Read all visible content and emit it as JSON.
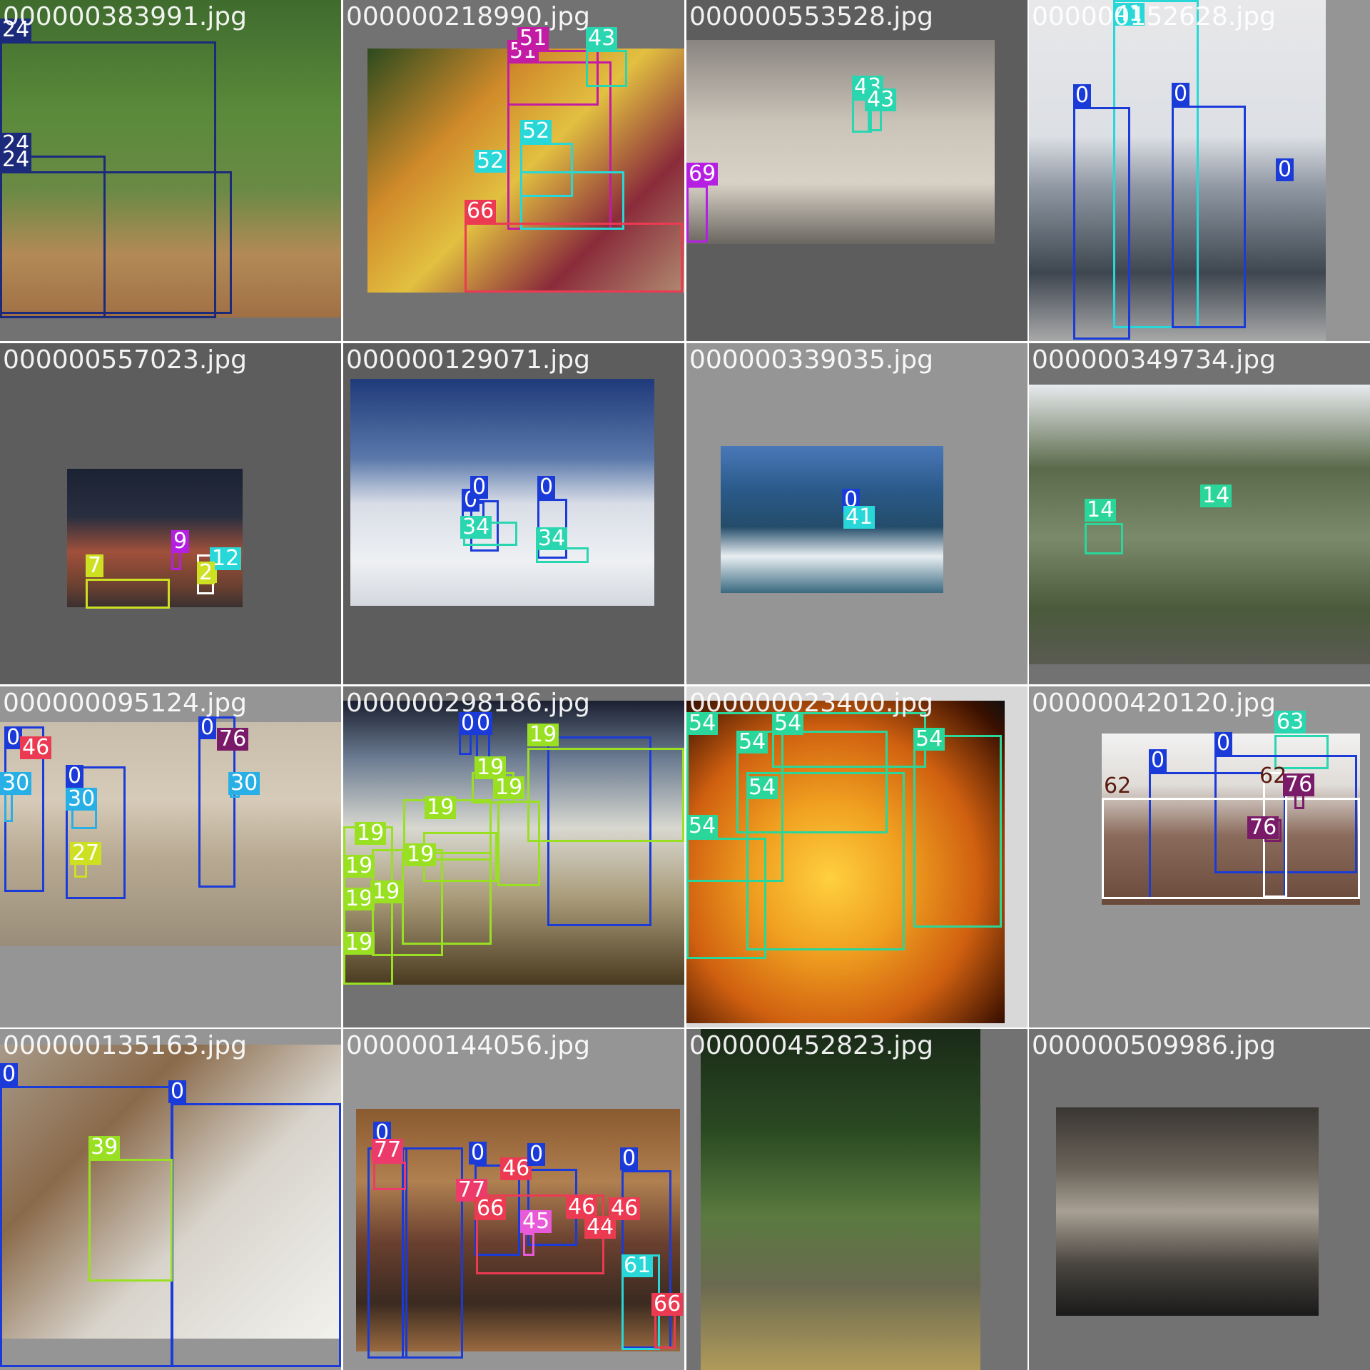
{
  "mosaic": {
    "tiles": [
      {
        "filename": "000000383991.jpg",
        "background": "#727272",
        "photo_fill": "linear-gradient(180deg,#3f6b2e 0%,#5a8a3a 35%,#6a8a45 60%,#b38a56 80%,#a07045 100%)",
        "labels": [
          {
            "text": "24",
            "color": "#1b2a7a"
          },
          {
            "text": "24",
            "color": "#1b2a7a"
          },
          {
            "text": "24",
            "color": "#1b2a7a"
          }
        ]
      },
      {
        "filename": "000000218990.jpg",
        "background": "#727272",
        "photo_fill": "linear-gradient(135deg,#2c4a1e 0%,#d08a2a 30%,#e2c040 50%,#8a2b3a 75%,#b08a70 100%)",
        "labels": [
          {
            "text": "51",
            "color": "#c41ba5"
          },
          {
            "text": "51",
            "color": "#c41ba5"
          },
          {
            "text": "43",
            "color": "#2ad6b0"
          },
          {
            "text": "52",
            "color": "#28d7d7"
          },
          {
            "text": "52",
            "color": "#28d7d7"
          },
          {
            "text": "66",
            "color": "#ec3a52"
          }
        ]
      },
      {
        "filename": "000000553528.jpg",
        "background": "#5d5d5d",
        "photo_fill": "linear-gradient(180deg,#8a8580 0%,#c9c3b8 40%,#d8d2c6 70%,#6a6660 100%)",
        "labels": [
          {
            "text": "43",
            "color": "#2ad6b0"
          },
          {
            "text": "43",
            "color": "#2ad6b0"
          },
          {
            "text": "69",
            "color": "#b51fe1"
          }
        ]
      },
      {
        "filename": "000000152628.jpg",
        "background": "#959595",
        "photo_fill": "linear-gradient(180deg,#e8e8ea 0%,#dcdfe4 40%,#8f97a2 55%,#3e4650 80%,#a8a8a8 100%)",
        "labels": [
          {
            "text": "41",
            "color": "#28d7d7"
          },
          {
            "text": "0",
            "color": "#1b3bd9"
          },
          {
            "text": "0",
            "color": "#1b3bd9"
          },
          {
            "text": "0",
            "color": "#1b3bd9"
          }
        ]
      },
      {
        "filename": "000000557023.jpg",
        "background": "#5d5d5d",
        "photo_fill": "linear-gradient(180deg,#1a2233 0%,#2a2f40 35%,#a0503a 60%,#6a4030 85%,#3a3030 100%)",
        "labels": [
          {
            "text": "9",
            "color": "#b51fe1"
          },
          {
            "text": "12",
            "color": "#28d7d7"
          },
          {
            "text": "7",
            "color": "#cde022"
          },
          {
            "text": "2",
            "color": "#cde022"
          }
        ]
      },
      {
        "filename": "000000129071.jpg",
        "background": "#5d5d5d",
        "photo_fill": "linear-gradient(180deg,#1f3a7a 0%,#5a78aa 35%,#d8dde6 55%,#eef0f3 80%,#d4d8de 100%)",
        "labels": [
          {
            "text": "0",
            "color": "#1b3bd9"
          },
          {
            "text": "0",
            "color": "#1b3bd9"
          },
          {
            "text": "0",
            "color": "#1b3bd9"
          },
          {
            "text": "34",
            "color": "#2ad6b0"
          },
          {
            "text": "34",
            "color": "#2ad6b0"
          }
        ]
      },
      {
        "filename": "000000339035.jpg",
        "background": "#959595",
        "photo_fill": "linear-gradient(180deg,#4a78b8 0%,#2a5a8a 30%,#244c6a 55%,#e8eef2 75%,#3a6a80 100%)",
        "labels": [
          {
            "text": "0",
            "color": "#1b3bd9"
          },
          {
            "text": "41",
            "color": "#28d7d7"
          }
        ]
      },
      {
        "filename": "000000349734.jpg",
        "background": "#727272",
        "photo_fill": "linear-gradient(180deg,#e8eaee 0%,#5a6a4a 30%,#7a8a6a 55%,#4a5a3a 80%,#5a5a52 100%)",
        "labels": [
          {
            "text": "14",
            "color": "#2ad69a"
          },
          {
            "text": "14",
            "color": "#2ad69a"
          }
        ]
      },
      {
        "filename": "000000095124.jpg",
        "background": "#959595",
        "photo_fill": "linear-gradient(180deg,#c8bcaa 0%,#d6cab8 35%,#b8aa92 60%,#9a8e7a 100%)",
        "labels": [
          {
            "text": "0",
            "color": "#1b3bd9"
          },
          {
            "text": "46",
            "color": "#ec3a52"
          },
          {
            "text": "0",
            "color": "#1b3bd9"
          },
          {
            "text": "76",
            "color": "#7a1b6a"
          },
          {
            "text": "30",
            "color": "#28b0e6"
          },
          {
            "text": "0",
            "color": "#1b3bd9"
          },
          {
            "text": "30",
            "color": "#28b0e6"
          },
          {
            "text": "30",
            "color": "#28b0e6"
          },
          {
            "text": "27",
            "color": "#cde022"
          }
        ]
      },
      {
        "filename": "000000298186.jpg",
        "background": "#727272",
        "photo_fill": "linear-gradient(180deg,#1a2030 0%,#6a7a90 20%,#d8d8d0 45%,#a89a78 70%,#4a3a20 100%)",
        "labels": [
          {
            "text": "0",
            "color": "#1b3bd9"
          },
          {
            "text": "0",
            "color": "#1b3bd9"
          },
          {
            "text": "19",
            "color": "#9ae022"
          },
          {
            "text": "19",
            "color": "#9ae022"
          },
          {
            "text": "19",
            "color": "#9ae022"
          },
          {
            "text": "19",
            "color": "#9ae022"
          },
          {
            "text": "19",
            "color": "#9ae022"
          },
          {
            "text": "19",
            "color": "#9ae022"
          },
          {
            "text": "19",
            "color": "#9ae022"
          },
          {
            "text": "19",
            "color": "#9ae022"
          },
          {
            "text": "19",
            "color": "#9ae022"
          },
          {
            "text": "19",
            "color": "#9ae022"
          }
        ]
      },
      {
        "filename": "000000023400.jpg",
        "background": "#d8d8d8",
        "photo_fill": "radial-gradient(ellipse at 45% 55%,#ffd040 0%,#f0a020 30%,#d06010 60%,#3a1000 90%,#101010 100%)",
        "labels": [
          {
            "text": "54",
            "color": "#2ad69a"
          },
          {
            "text": "54",
            "color": "#2ad69a"
          },
          {
            "text": "54",
            "color": "#2ad69a"
          },
          {
            "text": "54",
            "color": "#2ad69a"
          },
          {
            "text": "54",
            "color": "#2ad69a"
          },
          {
            "text": "54",
            "color": "#2ad69a"
          }
        ]
      },
      {
        "filename": "000000420120.jpg",
        "background": "#959595",
        "photo_fill": "linear-gradient(180deg,#f2f2f2 0%,#e0dcd8 30%,#8a6a5a 60%,#6a4a3a 100%)",
        "labels": [
          {
            "text": "63",
            "color": "#2ad6b0"
          },
          {
            "text": "0",
            "color": "#1b3bd9"
          },
          {
            "text": "0",
            "color": "#1b3bd9"
          },
          {
            "text": "62",
            "color": "#ffffff"
          },
          {
            "text": "62",
            "color": "#ffffff"
          },
          {
            "text": "76",
            "color": "#7a1b6a"
          },
          {
            "text": "76",
            "color": "#7a1b6a"
          }
        ]
      },
      {
        "filename": "000000135163.jpg",
        "background": "#959595",
        "photo_fill": "linear-gradient(135deg,#a89a8a 0%,#8a6a4a 30%,#d8d4cc 60%,#f2f2ee 100%)",
        "labels": [
          {
            "text": "0",
            "color": "#1b3bd9"
          },
          {
            "text": "0",
            "color": "#1b3bd9"
          },
          {
            "text": "39",
            "color": "#9ae022"
          }
        ]
      },
      {
        "filename": "000000144056.jpg",
        "background": "#959595",
        "photo_fill": "linear-gradient(180deg,#8a5a30 0%,#b08050 30%,#6a4030 55%,#3a2a20 80%,#9a6a40 100%)",
        "labels": [
          {
            "text": "0",
            "color": "#1b3bd9"
          },
          {
            "text": "77",
            "color": "#ec3a6a"
          },
          {
            "text": "0",
            "color": "#1b3bd9"
          },
          {
            "text": "46",
            "color": "#ec3a52"
          },
          {
            "text": "0",
            "color": "#1b3bd9"
          },
          {
            "text": "0",
            "color": "#1b3bd9"
          },
          {
            "text": "77",
            "color": "#ec3a6a"
          },
          {
            "text": "66",
            "color": "#ec3a52"
          },
          {
            "text": "45",
            "color": "#e85ad8"
          },
          {
            "text": "46",
            "color": "#ec3a52"
          },
          {
            "text": "44",
            "color": "#ec3a52"
          },
          {
            "text": "46",
            "color": "#ec3a52"
          },
          {
            "text": "61",
            "color": "#28d7d7"
          },
          {
            "text": "66",
            "color": "#ec3a52"
          }
        ]
      },
      {
        "filename": "000000452823.jpg",
        "background": "#727272",
        "photo_fill": "linear-gradient(180deg,#1a2a18 0%,#2a4a22 30%,#5a7a40 55%,#6a6a50 75%,#b09a5a 100%)",
        "labels": []
      },
      {
        "filename": "000000509986.jpg",
        "background": "#727272",
        "photo_fill": "linear-gradient(180deg,#3a3632 0%,#6a645a 30%,#a8a094 50%,#4a4640 75%,#1a1a1a 100%)",
        "labels": []
      }
    ]
  }
}
